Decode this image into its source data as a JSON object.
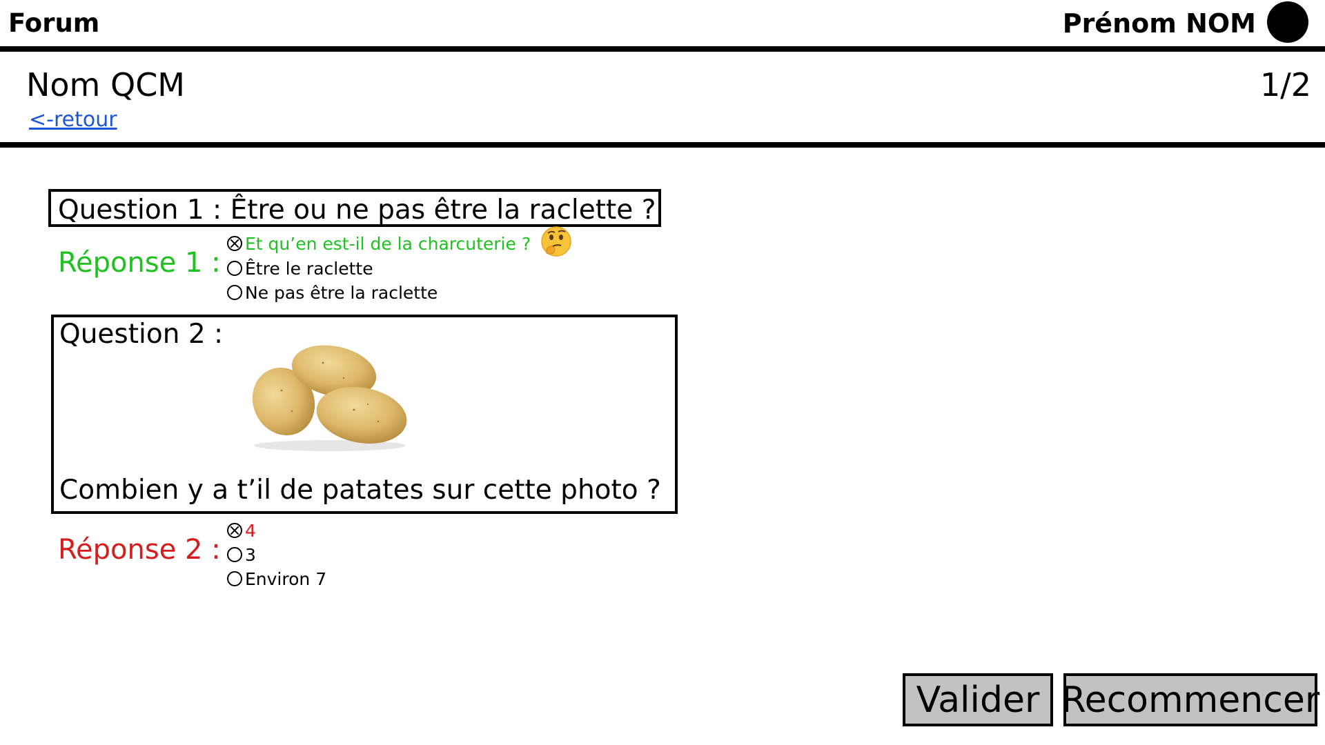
{
  "topbar": {
    "forum_label": "Forum",
    "user_name": "Prénom NOM"
  },
  "header": {
    "qcm_title": "Nom QCM",
    "page_counter": "1/2",
    "back_link": "<-retour"
  },
  "questions": [
    {
      "prompt": "Question 1 : Être ou ne pas être la raclette ?",
      "answer_label": "Réponse 1 :",
      "answer_color": "#1ec21e",
      "options": [
        {
          "label": "Et qu’en est-il de la charcuterie ?",
          "selected": true
        },
        {
          "label": "Être le raclette",
          "selected": false
        },
        {
          "label": "Ne pas être la raclette",
          "selected": false
        }
      ],
      "icon": "thinking-face-icon"
    },
    {
      "prompt_label": "Question 2 :",
      "prompt_text": "Combien y a t’il de patates sur cette photo ?",
      "image": "potatoes-photo",
      "answer_label": "Réponse 2 :",
      "answer_color": "#d61c1c",
      "options": [
        {
          "label": "4",
          "selected": true
        },
        {
          "label": "3",
          "selected": false
        },
        {
          "label": "Environ 7",
          "selected": false
        }
      ]
    }
  ],
  "actions": {
    "validate_label": "Valider",
    "restart_label": "Recommencer"
  },
  "colors": {
    "link": "#1a56d6",
    "button_bg": "#c2c2c2",
    "correct": "#1ec21e",
    "wrong": "#d61c1c"
  }
}
